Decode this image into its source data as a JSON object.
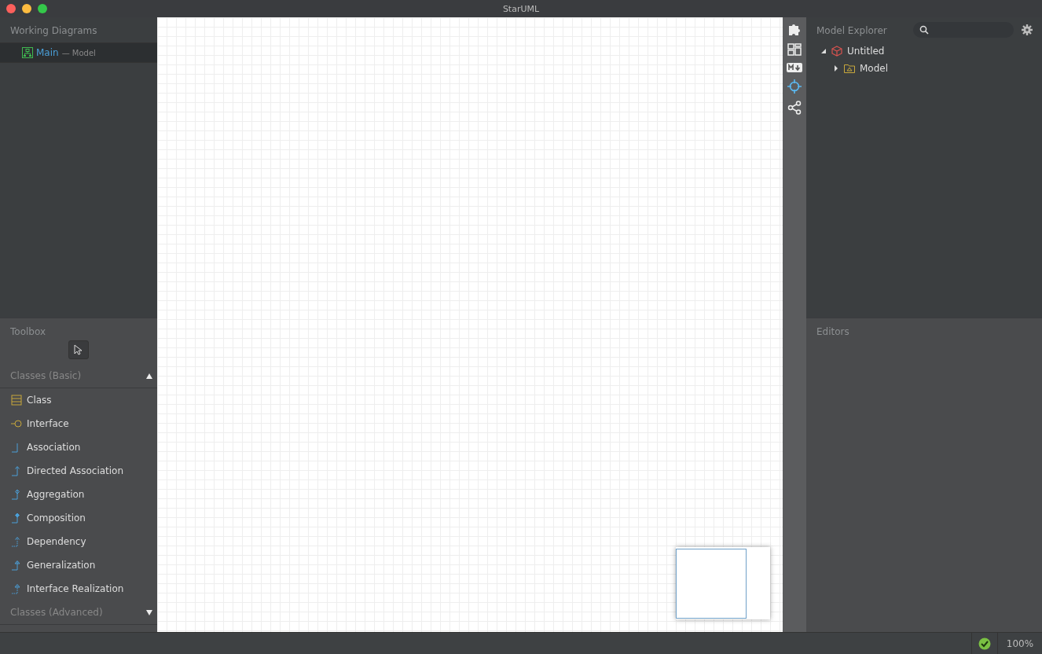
{
  "window": {
    "title": "StarUML"
  },
  "working_diagrams": {
    "title": "Working Diagrams",
    "items": [
      {
        "name": "Main",
        "owner": "— Model",
        "selected": true
      }
    ]
  },
  "toolbox": {
    "title": "Toolbox",
    "sections": [
      {
        "title": "Classes (Basic)",
        "expanded": true,
        "items": [
          {
            "label": "Class",
            "kind": "class"
          },
          {
            "label": "Interface",
            "kind": "interface"
          },
          {
            "label": "Association",
            "kind": "association"
          },
          {
            "label": "Directed Association",
            "kind": "directed"
          },
          {
            "label": "Aggregation",
            "kind": "aggregation"
          },
          {
            "label": "Composition",
            "kind": "composition"
          },
          {
            "label": "Dependency",
            "kind": "dependency"
          },
          {
            "label": "Generalization",
            "kind": "generalization"
          },
          {
            "label": "Interface Realization",
            "kind": "realization"
          }
        ]
      },
      {
        "title": "Classes (Advanced)",
        "expanded": false
      }
    ]
  },
  "model_explorer": {
    "title": "Model Explorer",
    "tree": [
      {
        "label": "Untitled",
        "kind": "project",
        "expanded": true,
        "children": [
          {
            "label": "Model",
            "kind": "model",
            "expanded": false
          }
        ]
      }
    ]
  },
  "editors": {
    "title": "Editors"
  },
  "status_bar": {
    "zoom": "100%"
  }
}
